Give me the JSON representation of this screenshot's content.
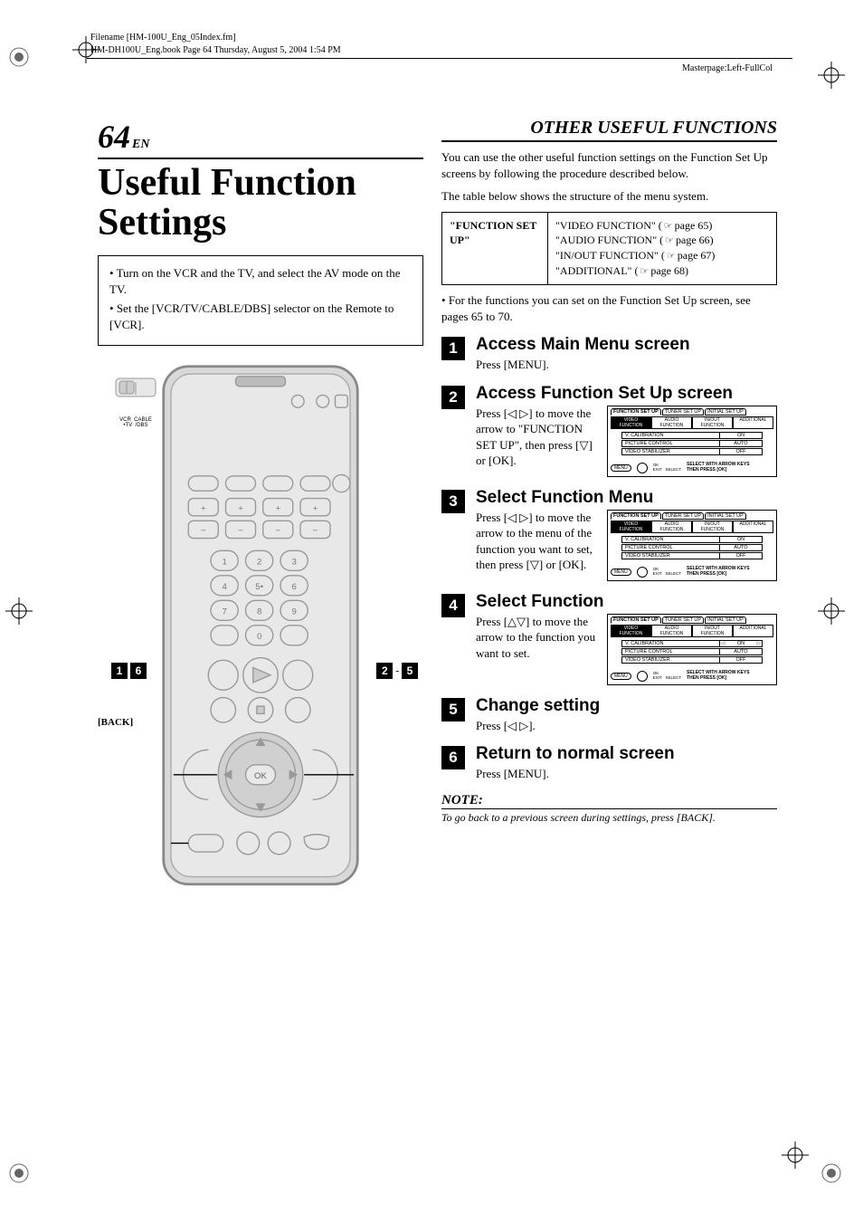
{
  "header": {
    "filename_line": "Filename [HM-100U_Eng_05Index.fm]",
    "book_line": "HM-DH100U_Eng.book  Page 64  Thursday, August 5, 2004  1:54 PM",
    "masterpage": "Masterpage:Left-FullCol"
  },
  "page_no": "64",
  "page_no_suffix": "EN",
  "section_title": "OTHER USEFUL FUNCTIONS",
  "main_heading": "Useful Function Settings",
  "left_box_items": [
    "Turn on the VCR and the TV, and select the AV mode on the TV.",
    "Set the [VCR/TV/CABLE/DBS] selector on the Remote to [VCR]."
  ],
  "remote": {
    "switch_labels": {
      "vcr": "VCR",
      "cable": "CABLE",
      "tv": "•TV",
      "dbs": "/DBS"
    },
    "callout_back": "[BACK]",
    "callout_16": [
      "1",
      "6"
    ],
    "callout_25": [
      "2",
      "-",
      "5"
    ]
  },
  "intro": [
    "You can use the other useful function settings on the Function Set Up screens by following the procedure described below.",
    "The table below shows the structure of the menu system."
  ],
  "menu_struct": {
    "left": "\"FUNCTION SET UP\"",
    "right": [
      {
        "label": "\"VIDEO FUNCTION\" (",
        "page": "page 65)"
      },
      {
        "label": "\"AUDIO FUNCTION\" (",
        "page": "page 66)"
      },
      {
        "label": "\"IN/OUT FUNCTION\" (",
        "page": "page 67)"
      },
      {
        "label": "\"ADDITIONAL\" (",
        "page": "page 68)"
      }
    ]
  },
  "bullet_after_table": "For the functions you can set on the Function Set Up screen, see pages 65 to 70.",
  "steps": [
    {
      "n": "1",
      "title": "Access Main Menu screen",
      "text": "Press [MENU].",
      "osd": null
    },
    {
      "n": "2",
      "title": "Access Function Set Up screen",
      "text": "Press [◁ ▷] to move the arrow to \"FUNCTION SET UP\", then press [▽] or [OK].",
      "osd": {
        "top_active": 0,
        "sub_active": 0,
        "row_arrows": -1
      }
    },
    {
      "n": "3",
      "title": "Select Function Menu",
      "text": "Press [◁ ▷] to move the arrow to the menu of the function you want to set, then press [▽] or [OK].",
      "osd": {
        "top_active": 0,
        "sub_active": 0,
        "row_arrows": -1
      }
    },
    {
      "n": "4",
      "title": "Select Function",
      "text": "Press [△▽] to move the arrow to the function you want to set.",
      "osd": {
        "top_active": 0,
        "sub_active": 0,
        "row_arrows": 0
      }
    },
    {
      "n": "5",
      "title": "Change setting",
      "text": "Press [◁ ▷].",
      "osd": null
    },
    {
      "n": "6",
      "title": "Return to normal screen",
      "text": "Press [MENU].",
      "osd": null
    }
  ],
  "osd_common": {
    "top_tabs": [
      "FUNCTION SET UP",
      "TUNER SET UP",
      "INITIAL SET UP"
    ],
    "sub_tabs": [
      "VIDEO FUNCTION",
      "AUDIO FUNCTION",
      "IN/OUT FUNCTION",
      "ADDITIONAL"
    ],
    "rows": [
      {
        "k": "V. CALIBRATION",
        "v": "ON"
      },
      {
        "k": "PICTURE CONTROL",
        "v": "AUTO"
      },
      {
        "k": "VIDEO STABILIZER",
        "v": "OFF"
      }
    ],
    "footer": {
      "pill": "MENU",
      "ok": "OK",
      "exit": "EXIT",
      "select": "SELECT",
      "hint1": "SELECT WITH ARROW KEYS",
      "hint2": "THEN PRESS [OK]"
    }
  },
  "note": {
    "head": "NOTE:",
    "body": "To go back to a previous screen during settings, press [BACK]."
  }
}
